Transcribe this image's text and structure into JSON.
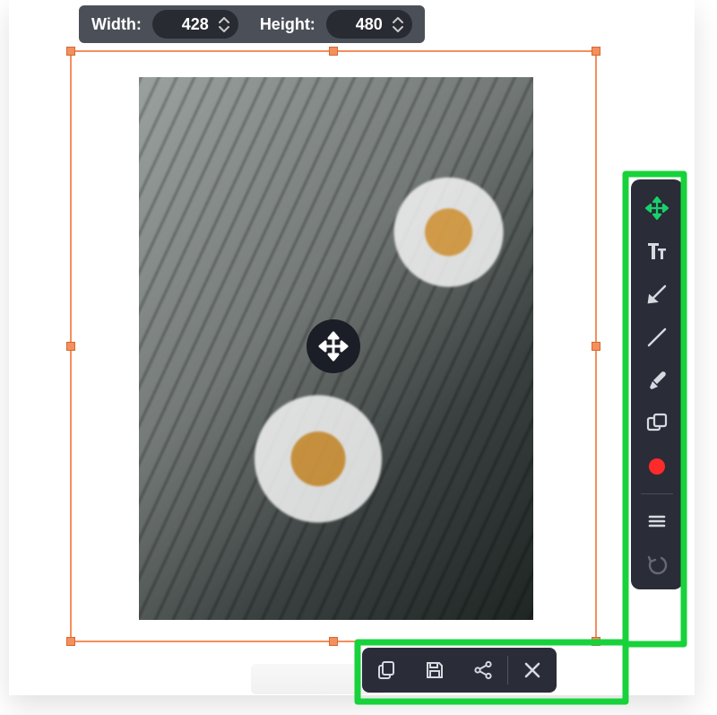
{
  "dimensions": {
    "width_label": "Width:",
    "width_value": "428",
    "height_label": "Height:",
    "height_value": "480"
  },
  "colors": {
    "selection": "#f58f5b",
    "toolbar_bg": "#2a2c38",
    "highlight": "#18d23b",
    "accent_active": "#18d26a",
    "record": "#ff2a2a"
  },
  "vtoolbar": {
    "items": [
      {
        "name": "move-tool",
        "icon": "move-icon",
        "active": true
      },
      {
        "name": "text-tool",
        "icon": "text-icon",
        "active": false
      },
      {
        "name": "arrow-tool",
        "icon": "arrow-icon",
        "active": false
      },
      {
        "name": "line-tool",
        "icon": "line-icon",
        "active": false
      },
      {
        "name": "highlighter",
        "icon": "highlighter-icon",
        "active": false
      },
      {
        "name": "shape-tool",
        "icon": "shape-icon",
        "active": false
      },
      {
        "name": "record-tool",
        "icon": "record-icon",
        "active": false
      },
      {
        "name": "menu-tool",
        "icon": "menu-icon",
        "active": false
      },
      {
        "name": "undo-tool",
        "icon": "undo-icon",
        "active": false,
        "disabled": true
      }
    ]
  },
  "bottombar": {
    "items": [
      {
        "name": "copy-button",
        "icon": "copy-icon"
      },
      {
        "name": "save-button",
        "icon": "save-icon"
      },
      {
        "name": "share-button",
        "icon": "share-icon"
      },
      {
        "name": "close-button",
        "icon": "close-icon"
      }
    ]
  },
  "selection": {
    "move_badge": "move-handle"
  }
}
